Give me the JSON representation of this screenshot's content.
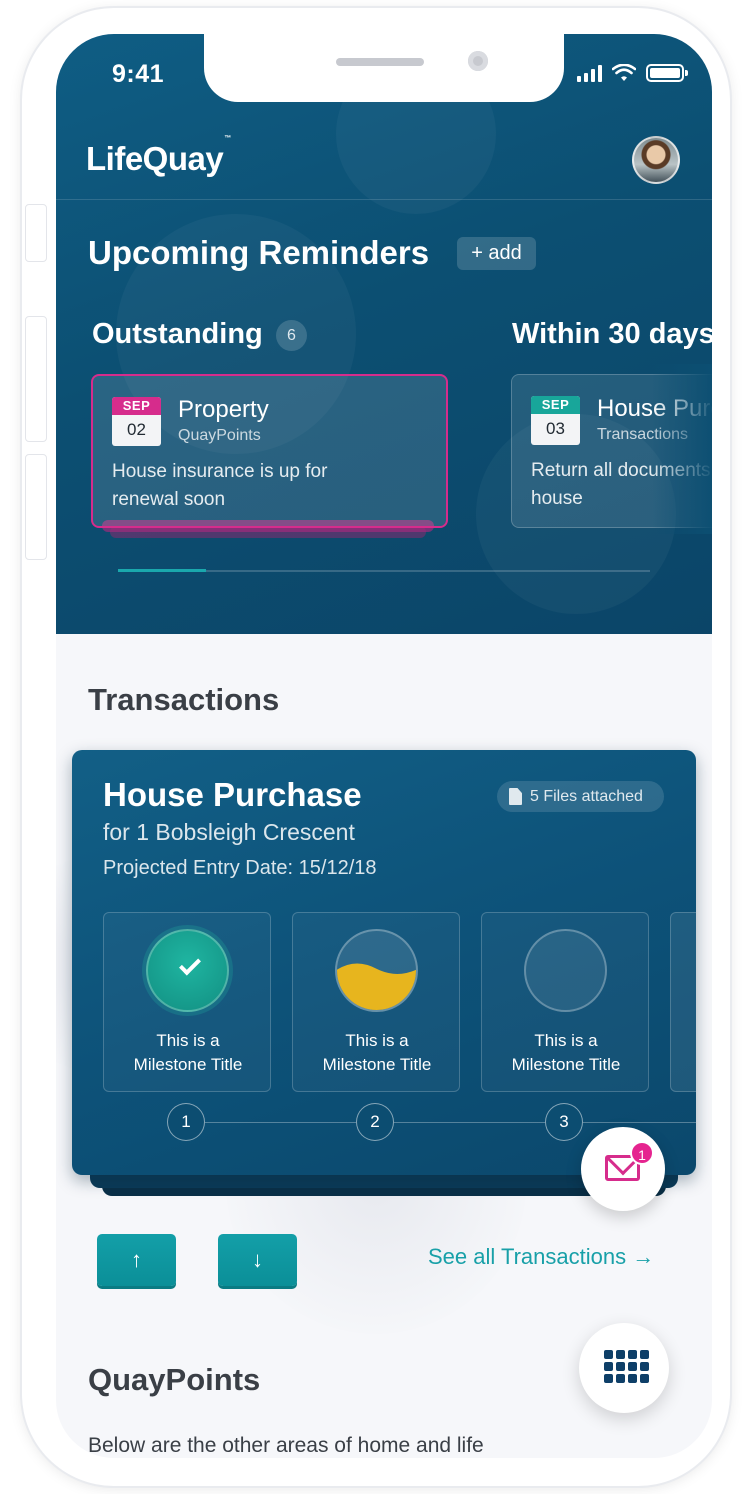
{
  "status_bar": {
    "time": "9:41"
  },
  "app": {
    "brand_name": "LifeQuay",
    "brand_mark": "™"
  },
  "reminders": {
    "heading": "Upcoming Reminders",
    "add_label": "+ add",
    "outstanding": {
      "heading": "Outstanding",
      "count": "6",
      "card": {
        "month": "SEP",
        "day": "02",
        "title": "Property",
        "category": "QuayPoints",
        "body": "House insurance is up for renewal soon",
        "accent": "#d62c8c"
      }
    },
    "within_30": {
      "heading": "Within 30 days",
      "card": {
        "month": "SEP",
        "day": "03",
        "title": "House Purchase",
        "category": "Transactions",
        "body": "Return all documents for current house",
        "accent": "#18a69a"
      }
    }
  },
  "transactions": {
    "heading": "Transactions",
    "card": {
      "title": "House Purchase",
      "subtitle": "for 1 Bobsleigh Crescent",
      "projected_date": "Projected Entry Date: 15/12/18",
      "files_label": "5 Files attached",
      "milestones": [
        {
          "number": "1",
          "title_line1": "This is a",
          "title_line2": "Milestone Title",
          "state": "complete"
        },
        {
          "number": "2",
          "title_line1": "This is a",
          "title_line2": "Milestone Title",
          "state": "in-progress"
        },
        {
          "number": "3",
          "title_line1": "This is a",
          "title_line2": "Milestone Title",
          "state": "not-started"
        }
      ]
    },
    "mail_badge_count": "1",
    "up_label": "↑",
    "down_label": "↓",
    "see_all_label": "See all Transactions →"
  },
  "quaypoints": {
    "heading": "QuayPoints",
    "description": "Below are the other areas of home and life"
  },
  "colors": {
    "primary": "#0c4f72",
    "accent_teal": "#18a0a8",
    "accent_pink": "#d62c8c",
    "progress_yellow": "#e7b51e"
  },
  "icons": [
    "signal-icon",
    "wifi-icon",
    "battery-icon",
    "calendar-icon",
    "document-icon",
    "check-icon",
    "mail-icon",
    "arrow-up-icon",
    "arrow-down-icon",
    "grid-menu-icon"
  ]
}
